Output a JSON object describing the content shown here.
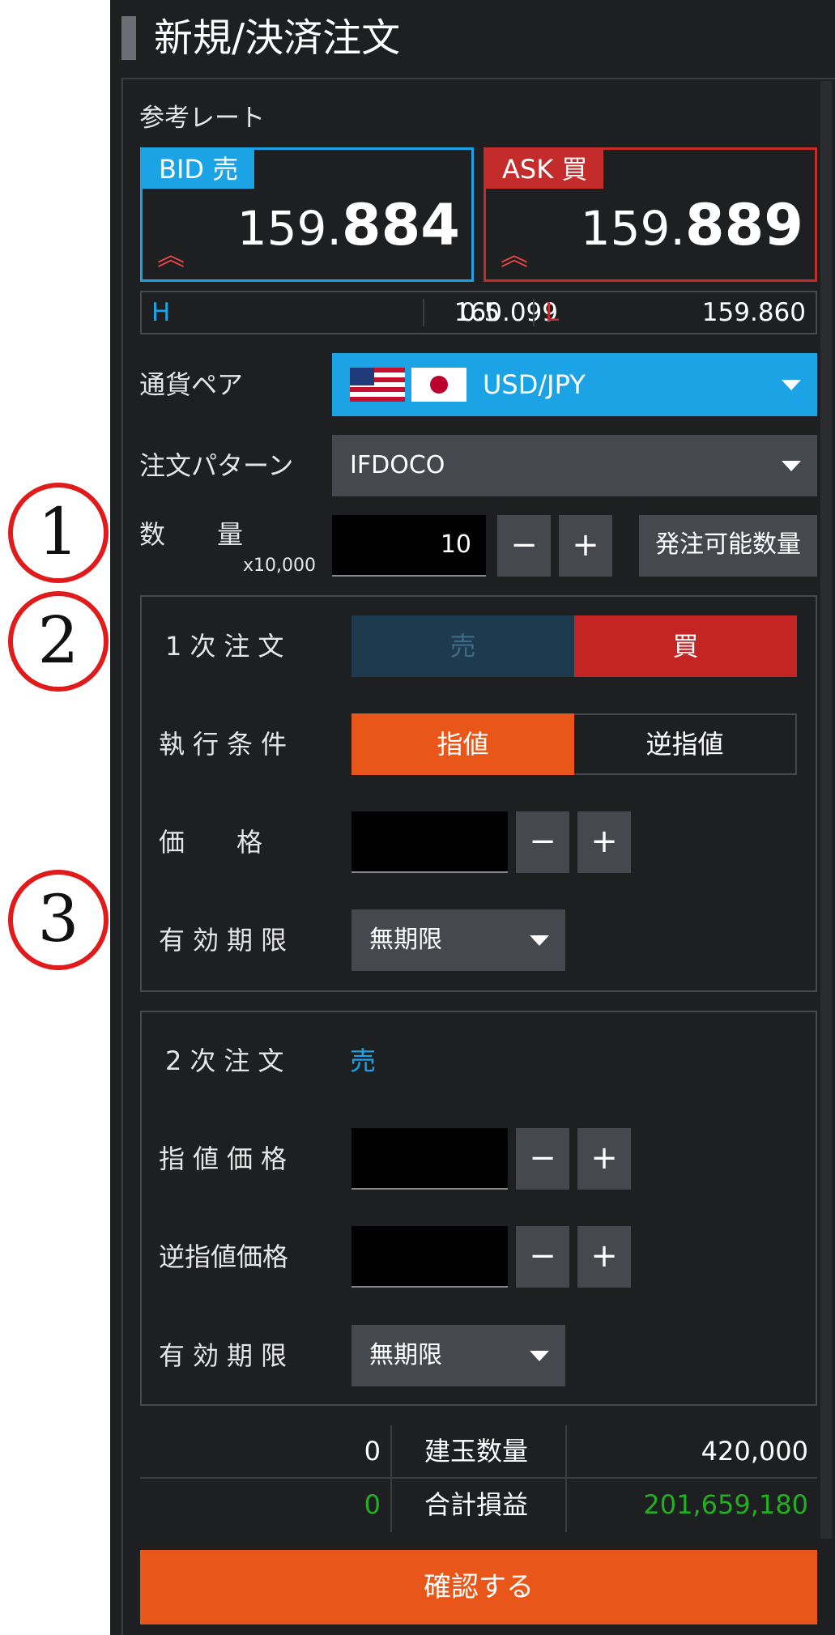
{
  "panel": {
    "title": "新規/決済注文",
    "reference_rate_label": "参考レート"
  },
  "bid": {
    "tag": "BID 売",
    "price_small": "159.",
    "price_big": "884",
    "arrow": "︽"
  },
  "ask": {
    "tag": "ASK 買",
    "price_small": "159.",
    "price_big": "889",
    "arrow": "︽"
  },
  "hl": {
    "h_label": "H",
    "high": "160.099",
    "spread": "0.5",
    "l_label": "L",
    "low": "159.860"
  },
  "currency_pair": {
    "label": "通貨ペア",
    "value": "USD/JPY"
  },
  "order_pattern": {
    "label": "注文パターン",
    "value": "IFDOCO"
  },
  "quantity": {
    "label": "数　　量",
    "unit": "x10,000",
    "value": "10",
    "minus": "−",
    "plus": "+",
    "available_button": "発注可能数量"
  },
  "first_order": {
    "label": "1次注文",
    "sell": "売",
    "buy": "買",
    "exec_label": "執行条件",
    "limit": "指値",
    "stop": "逆指値",
    "price_label": "価　　格",
    "minus": "−",
    "plus": "+",
    "expiry_label": "有効期限",
    "expiry_value": "無期限"
  },
  "second_order": {
    "label": "2次注文",
    "side": "売",
    "limit_price_label": "指値価格",
    "stop_price_label": "逆指値価格",
    "minus": "−",
    "plus": "+",
    "expiry_label": "有効期限",
    "expiry_value": "無期限"
  },
  "summary": {
    "position_count_left": "0",
    "position_label": "建玉数量",
    "position_value": "420,000",
    "pnl_left": "0",
    "pnl_label": "合計損益",
    "pnl_value": "201,659,180"
  },
  "confirm_button": "確認する",
  "annotations": [
    "1",
    "2",
    "3"
  ],
  "colors": {
    "bid": "#1ba3e6",
    "ask": "#c42b2b",
    "accent_orange": "#e8561a",
    "profit_green": "#22b022",
    "panel_bg": "#1e1f21"
  }
}
